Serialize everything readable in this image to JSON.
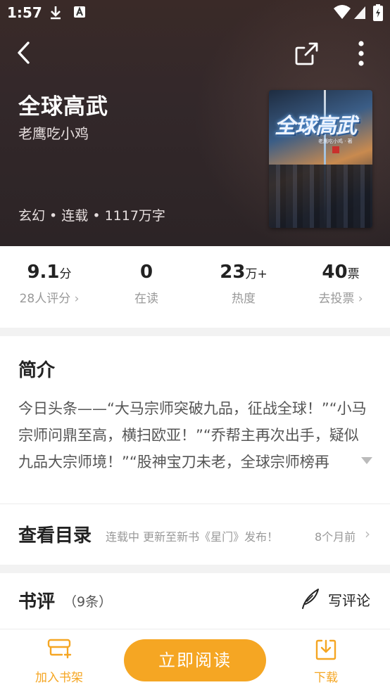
{
  "status_bar": {
    "time": "1:57"
  },
  "book": {
    "title": "全球高武",
    "author": "老鹰吃小鸡",
    "meta": "玄幻 • 连载 • 1117万字",
    "cover_title": "全球高武",
    "cover_subtitle": "老鹰吃小鸡 · 著"
  },
  "stats": [
    {
      "value": "9.1",
      "unit": "分",
      "label": "28人评分",
      "has_chevron": true
    },
    {
      "value": "0",
      "unit": "",
      "label": "在读",
      "has_chevron": false
    },
    {
      "value": "23",
      "unit": "万+",
      "label": "热度",
      "has_chevron": false
    },
    {
      "value": "40",
      "unit": "票",
      "label": "去投票",
      "has_chevron": true
    }
  ],
  "intro": {
    "heading": "简介",
    "text": "今日头条——“大马宗师突破九品，征战全球！”“小马宗师问鼎至高，横扫欧亚！”“乔帮主再次出手，疑似九品大宗师境！”“股神宝刀未老，全球宗师榜再"
  },
  "catalog": {
    "title": "查看目录",
    "status": "连载中 更新至新书《星门》发布！",
    "updated": "8个月前"
  },
  "reviews": {
    "title": "书评",
    "count": "（9条）",
    "write_label": "写评论"
  },
  "bottom_bar": {
    "shelf_label": "加入书架",
    "read_label": "立即阅读",
    "download_label": "下载"
  },
  "colors": {
    "accent": "#f5a623",
    "header_bg": "#33282a"
  }
}
